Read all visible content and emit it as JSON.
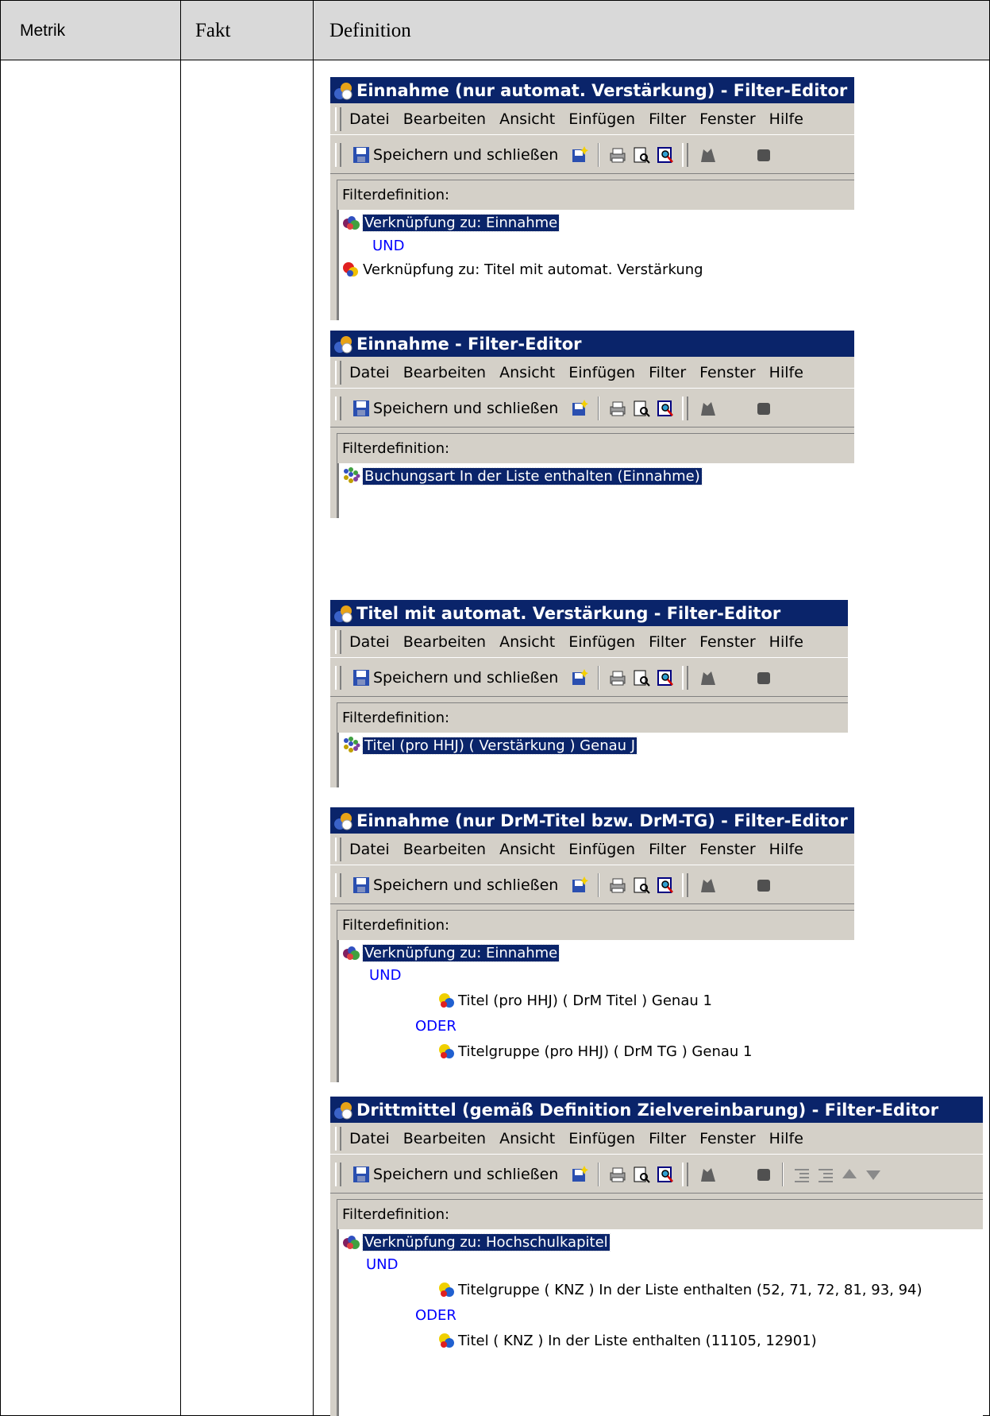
{
  "table": {
    "headers": {
      "metrik": "Metrik",
      "fakt": "Fakt",
      "definition": "Definition"
    }
  },
  "menu": {
    "datei": "Datei",
    "bearbeiten": "Bearbeiten",
    "ansicht": "Ansicht",
    "einfuegen": "Einfügen",
    "filter": "Filter",
    "fenster": "Fenster",
    "hilfe": "Hilfe"
  },
  "toolbar": {
    "save_close": "Speichern und schließen"
  },
  "panel_label": "Filterdefinition:",
  "editors": [
    {
      "title": "Einnahme (nur automat. Verstärkung) - Filter-Editor",
      "rows": [
        "Verknüpfung zu: Einnahme",
        "UND",
        "Verknüpfung zu: Titel mit automat. Verstärkung"
      ]
    },
    {
      "title": "Einnahme - Filter-Editor",
      "rows": [
        "Buchungsart In der Liste enthalten (Einnahme)"
      ]
    },
    {
      "title": "Titel mit automat. Verstärkung - Filter-Editor",
      "rows": [
        "Titel (pro HHJ) ( Verstärkung )  Genau J"
      ]
    },
    {
      "title": "Einnahme (nur DrM-Titel bzw. DrM-TG) - Filter-Editor",
      "rows": [
        "Verknüpfung zu: Einnahme",
        "UND",
        "Titel (pro HHJ) ( DrM Titel )  Genau 1",
        "ODER",
        "Titelgruppe (pro HHJ) ( DrM TG )  Genau 1"
      ]
    },
    {
      "title": "Drittmittel (gemäß Definition Zielvereinbarung) - Filter-Editor",
      "rows": [
        "Verknüpfung zu: Hochschulkapitel",
        "UND",
        "Titelgruppe ( KNZ )  In der Liste enthalten (52, 71, 72, 81, 93, 94)",
        "ODER",
        "Titel ( KNZ )  In der Liste enthalten (11105, 12901)"
      ]
    }
  ]
}
